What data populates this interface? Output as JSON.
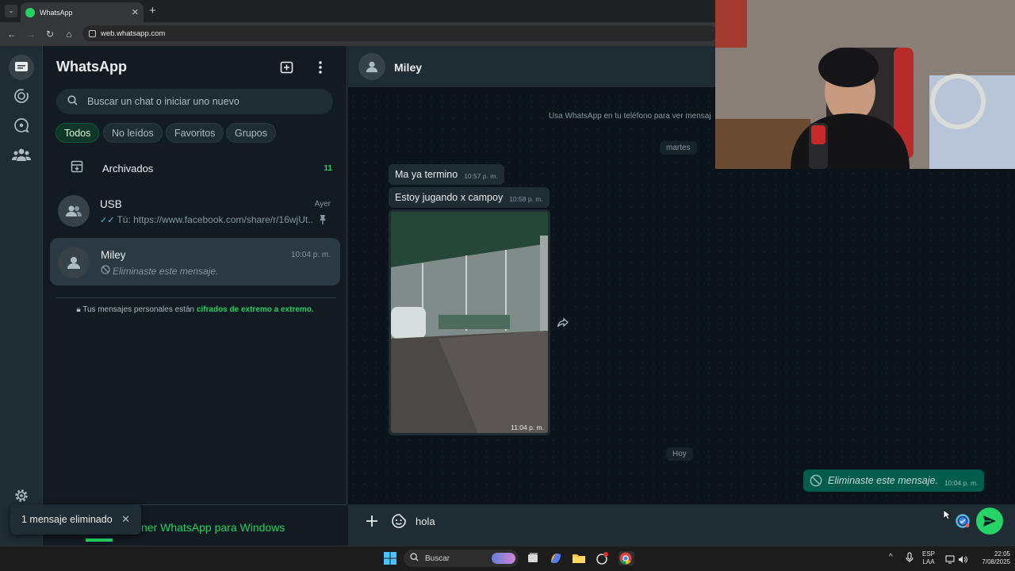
{
  "browser": {
    "tab_title": "WhatsApp",
    "url": "web.whatsapp.com"
  },
  "sidebar": {
    "title": "WhatsApp",
    "search_placeholder": "Buscar un chat o iniciar uno nuevo",
    "filters": [
      {
        "label": "Todos",
        "active": true
      },
      {
        "label": "No leídos",
        "active": false
      },
      {
        "label": "Favoritos",
        "active": false
      },
      {
        "label": "Grupos",
        "active": false
      }
    ],
    "archived": {
      "label": "Archivados",
      "count": "11"
    },
    "chats": [
      {
        "name": "USB",
        "time": "Ayer",
        "preview": "Tú: https://www.facebook.com/share/r/16wjUt...",
        "pinned": true
      },
      {
        "name": "Miley",
        "time": "10:04 p. m.",
        "preview": "Eliminaste este mensaje.",
        "active": true
      }
    ],
    "e2e_text": "Tus mensajes personales están ",
    "e2e_link": "cifrados de extremo a extremo.",
    "promo_text": "ner WhatsApp para Windows"
  },
  "toast": {
    "text": "1 mensaje eliminado"
  },
  "conversation": {
    "contact_name": "Miley",
    "system_notice": "Usa WhatsApp en tu teléfono para ver mensaj",
    "day_tuesday": "martes",
    "day_today": "Hoy",
    "messages": [
      {
        "text": "Ma ya termino",
        "time": "10:57 p. m."
      },
      {
        "text": "Estoy jugando x campoy",
        "time": "10:58 p. m."
      },
      {
        "image": true,
        "time": "11:04 p. m."
      },
      {
        "text": "Eliminaste este mensaje.",
        "time": "10:04 p. m.",
        "outgoing": true,
        "deleted": true
      }
    ],
    "composer_value": "hola"
  },
  "taskbar": {
    "search_label": "Buscar",
    "lang_1": "ESP",
    "lang_2": "LAA",
    "time": "22:05",
    "date": "7/08/2025"
  },
  "colors": {
    "accent": "#25d366",
    "panel": "#111b21",
    "header": "#202c33",
    "outgoing_bubble": "#005c4b"
  }
}
